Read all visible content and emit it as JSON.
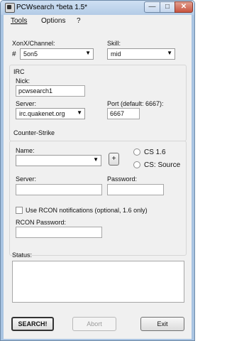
{
  "window": {
    "title": "PCWsearch *beta 1.5*"
  },
  "menu": [
    "Tools",
    "Options",
    "?"
  ],
  "xonx": {
    "label": "XonX/Channel:",
    "prefix": "#",
    "value": "5on5"
  },
  "skill": {
    "label": "Skill:",
    "value": "mid"
  },
  "irc": {
    "group_title": "IRC",
    "nick_label": "Nick:",
    "nick_value": "pcwsearch1",
    "server_label": "Server:",
    "server_value": "irc.quakenet.org",
    "port_label": "Port (default: 6667):",
    "port_value": "6667"
  },
  "cs": {
    "group_title": "Counter-Strike",
    "name_label": "Name:",
    "name_value": "",
    "add_button": "+",
    "radio_16": "CS 1.6",
    "radio_source": "CS: Source",
    "server_label": "Server:",
    "server_value": "",
    "password_label": "Password:",
    "password_value": "",
    "rcon_checkbox": "Use RCON notifications (optional, 1.6 only)",
    "rcon_password_label": "RCON Password:",
    "rcon_password_value": ""
  },
  "status": {
    "label": "Status:",
    "text": ""
  },
  "buttons": {
    "search": "SEARCH!",
    "abort": "Abort",
    "exit": "Exit"
  }
}
